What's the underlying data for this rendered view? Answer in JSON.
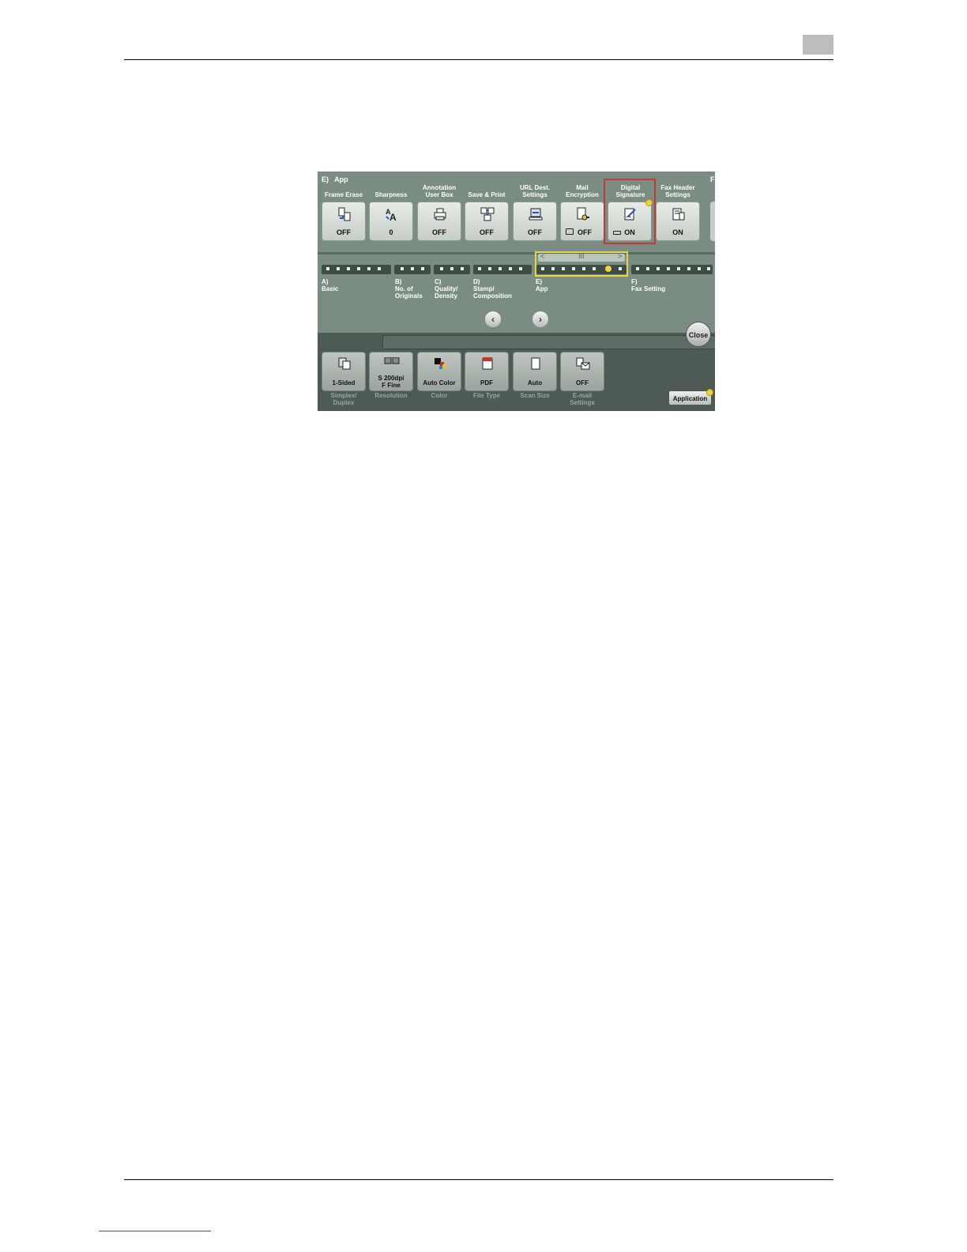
{
  "panel": {
    "section_title": "E)   App",
    "partial_label": "F",
    "functions": [
      {
        "label": "Frame Erase",
        "value": "OFF",
        "icon": "frame-erase-icon"
      },
      {
        "label": "Sharpness",
        "value": "0",
        "icon": "sharpness-icon"
      },
      {
        "label": "Annotation\nUser Box",
        "value": "OFF",
        "icon": "annotation-icon"
      },
      {
        "label": "Save & Print",
        "value": "OFF",
        "icon": "save-print-icon"
      },
      {
        "label": "URL Dest.\nSettings",
        "value": "OFF",
        "icon": "url-dest-icon"
      },
      {
        "label": "Mail\nEncryption",
        "value": "OFF",
        "icon": "mail-encryption-icon"
      },
      {
        "label": "Digital\nSignature",
        "value": "ON",
        "icon": "digital-signature-icon"
      },
      {
        "label": "Fax Header\nSettings",
        "value": "ON",
        "icon": "fax-header-icon"
      }
    ],
    "categories": [
      {
        "label": "A)\nBasic"
      },
      {
        "label": "B)\nNo. of\nOriginals"
      },
      {
        "label": "C)\nQuality/\nDensity"
      },
      {
        "label": "D)\nStamp/\nComposition"
      },
      {
        "label": "E)\nApp"
      },
      {
        "label": "F)\nFax Setting"
      }
    ],
    "slider": {
      "left": "<",
      "mid": "III",
      "right": ">"
    },
    "prev_arrow": "‹",
    "next_arrow": "›",
    "close_label": "Close",
    "bottom_buttons": [
      {
        "value": "1-Sided",
        "label": "Simplex/\nDuplex",
        "icon": "simplex-icon"
      },
      {
        "value": "S 200dpi\nF Fine",
        "label": "Resolution",
        "icon": "resolution-icon"
      },
      {
        "value": "Auto Color",
        "label": "Color",
        "icon": "color-icon"
      },
      {
        "value": "PDF",
        "label": "File Type",
        "icon": "pdf-icon"
      },
      {
        "value": "Auto",
        "label": "Scan Size",
        "icon": "scan-size-icon"
      },
      {
        "value": "OFF",
        "label": "E-mail\nSettings",
        "icon": "email-icon"
      }
    ],
    "application_label": "Application"
  },
  "colors": {
    "highlight": "#c0393b",
    "indicator": "#f5d23c",
    "panel": "#7b8c83"
  }
}
